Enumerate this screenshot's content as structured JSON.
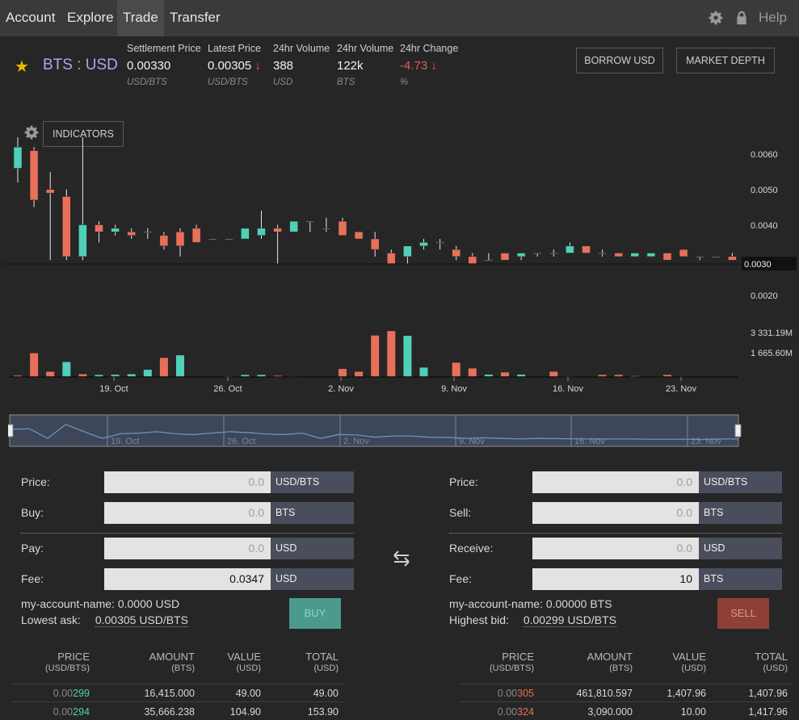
{
  "nav": {
    "items": [
      {
        "label": "Account",
        "active": false
      },
      {
        "label": "Explore",
        "active": false
      },
      {
        "label": "Trade",
        "active": true
      },
      {
        "label": "Transfer",
        "active": false
      }
    ],
    "help_label": "Help",
    "icons": [
      "gear-icon",
      "lock-icon"
    ]
  },
  "market": {
    "pair": "BTS : USD",
    "stats": [
      {
        "label": "Settlement Price",
        "value": "0.00330",
        "unit": "USD/BTS",
        "negative": false,
        "arrow": ""
      },
      {
        "label": "Latest Price",
        "value": "0.00305",
        "unit": "USD/BTS",
        "negative": false,
        "arrow": "↓"
      },
      {
        "label": "24hr Volume",
        "value": "388",
        "unit": "USD",
        "negative": false,
        "arrow": ""
      },
      {
        "label": "24hr Volume",
        "value": "122k",
        "unit": "BTS",
        "negative": false,
        "arrow": ""
      },
      {
        "label": "24hr Change",
        "value": "-4.73",
        "unit": "%",
        "negative": true,
        "arrow": "↓"
      }
    ],
    "borrow_label": "BORROW USD",
    "depth_label": "MARKET DEPTH"
  },
  "chart": {
    "indicators_label": "INDICATORS",
    "price_ticks": [
      "0.0060",
      "0.0050",
      "0.0040",
      "0.0030",
      "0.0020"
    ],
    "current_price_label": "0.0030",
    "volume_ticks": [
      "3 331.19M",
      "1 665.60M"
    ],
    "date_ticks": [
      "19. Oct",
      "26. Oct",
      "2. Nov",
      "9. Nov",
      "16. Nov",
      "23. Nov"
    ],
    "colors": {
      "up": "#4fd0b8",
      "down": "#e8705a"
    }
  },
  "chart_data": {
    "type": "candlestick",
    "ylim": [
      0.0015,
      0.0068
    ],
    "candles": [
      {
        "o": 0.0056,
        "h": 0.0066,
        "l": 0.0052,
        "c": 0.0062
      },
      {
        "o": 0.0061,
        "h": 0.0062,
        "l": 0.0045,
        "c": 0.0047
      },
      {
        "o": 0.005,
        "h": 0.0055,
        "l": 0.003,
        "c": 0.0049
      },
      {
        "o": 0.0048,
        "h": 0.005,
        "l": 0.003,
        "c": 0.0031
      },
      {
        "o": 0.0031,
        "h": 0.0066,
        "l": 0.003,
        "c": 0.004
      },
      {
        "o": 0.004,
        "h": 0.0041,
        "l": 0.0035,
        "c": 0.0038
      },
      {
        "o": 0.0038,
        "h": 0.004,
        "l": 0.0037,
        "c": 0.0039
      },
      {
        "o": 0.0038,
        "h": 0.0039,
        "l": 0.0036,
        "c": 0.0037
      },
      {
        "o": 0.0038,
        "h": 0.0039,
        "l": 0.0036,
        "c": 0.0038
      },
      {
        "o": 0.0037,
        "h": 0.0038,
        "l": 0.0033,
        "c": 0.0034
      },
      {
        "o": 0.0038,
        "h": 0.0039,
        "l": 0.0031,
        "c": 0.0034
      },
      {
        "o": 0.0039,
        "h": 0.004,
        "l": 0.0036,
        "c": 0.0035
      },
      {
        "o": 0.0036,
        "h": 0.0036,
        "l": 0.0036,
        "c": 0.0036
      },
      {
        "o": 0.0036,
        "h": 0.0036,
        "l": 0.0036,
        "c": 0.0036
      },
      {
        "o": 0.0036,
        "h": 0.0039,
        "l": 0.0036,
        "c": 0.0039
      },
      {
        "o": 0.0037,
        "h": 0.0044,
        "l": 0.0036,
        "c": 0.0039
      },
      {
        "o": 0.0039,
        "h": 0.004,
        "l": 0.0029,
        "c": 0.0038
      },
      {
        "o": 0.0038,
        "h": 0.0041,
        "l": 0.0038,
        "c": 0.0041
      },
      {
        "o": 0.0041,
        "h": 0.0041,
        "l": 0.0038,
        "c": 0.0041
      },
      {
        "o": 0.0039,
        "h": 0.0042,
        "l": 0.0038,
        "c": 0.0039
      },
      {
        "o": 0.0041,
        "h": 0.0042,
        "l": 0.0037,
        "c": 0.0037
      },
      {
        "o": 0.0038,
        "h": 0.0038,
        "l": 0.0036,
        "c": 0.0036
      },
      {
        "o": 0.0036,
        "h": 0.0038,
        "l": 0.0031,
        "c": 0.0033
      },
      {
        "o": 0.0032,
        "h": 0.0033,
        "l": 0.0029,
        "c": 0.0029
      },
      {
        "o": 0.0031,
        "h": 0.0034,
        "l": 0.0029,
        "c": 0.0034
      },
      {
        "o": 0.0034,
        "h": 0.0036,
        "l": 0.0033,
        "c": 0.0035
      },
      {
        "o": 0.0035,
        "h": 0.0036,
        "l": 0.0033,
        "c": 0.0035
      },
      {
        "o": 0.0033,
        "h": 0.0034,
        "l": 0.003,
        "c": 0.0031
      },
      {
        "o": 0.0031,
        "h": 0.0032,
        "l": 0.0029,
        "c": 0.0029
      },
      {
        "o": 0.003,
        "h": 0.0032,
        "l": 0.003,
        "c": 0.003
      },
      {
        "o": 0.0032,
        "h": 0.0032,
        "l": 0.003,
        "c": 0.003
      },
      {
        "o": 0.0031,
        "h": 0.0032,
        "l": 0.003,
        "c": 0.0032
      },
      {
        "o": 0.0032,
        "h": 0.0032,
        "l": 0.0031,
        "c": 0.0032
      },
      {
        "o": 0.0032,
        "h": 0.0033,
        "l": 0.0031,
        "c": 0.0032
      },
      {
        "o": 0.0032,
        "h": 0.0035,
        "l": 0.0032,
        "c": 0.0034
      },
      {
        "o": 0.0034,
        "h": 0.0034,
        "l": 0.0032,
        "c": 0.0032
      },
      {
        "o": 0.0032,
        "h": 0.0033,
        "l": 0.0031,
        "c": 0.0032
      },
      {
        "o": 0.0032,
        "h": 0.0032,
        "l": 0.0031,
        "c": 0.0031
      },
      {
        "o": 0.0031,
        "h": 0.0032,
        "l": 0.0031,
        "c": 0.0032
      },
      {
        "o": 0.0031,
        "h": 0.0032,
        "l": 0.0031,
        "c": 0.0032
      },
      {
        "o": 0.0032,
        "h": 0.0032,
        "l": 0.003,
        "c": 0.003
      },
      {
        "o": 0.0033,
        "h": 0.0033,
        "l": 0.0031,
        "c": 0.0031
      },
      {
        "o": 0.0031,
        "h": 0.0031,
        "l": 0.003,
        "c": 0.0031
      },
      {
        "o": 0.0031,
        "h": 0.0031,
        "l": 0.0031,
        "c": 0.0031
      },
      {
        "o": 0.0031,
        "h": 0.0032,
        "l": 0.003,
        "c": 0.003
      }
    ],
    "volume_ylim": [
      0,
      3700
    ],
    "volume": [
      {
        "v": 100,
        "up": false
      },
      {
        "v": 1720,
        "up": false
      },
      {
        "v": 380,
        "up": false
      },
      {
        "v": 1080,
        "up": true
      },
      {
        "v": 200,
        "up": false
      },
      {
        "v": 150,
        "up": true
      },
      {
        "v": 160,
        "up": true
      },
      {
        "v": 200,
        "up": true
      },
      {
        "v": 520,
        "up": true
      },
      {
        "v": 1380,
        "up": false
      },
      {
        "v": 1570,
        "up": true
      },
      {
        "v": 0,
        "up": true
      },
      {
        "v": 0,
        "up": true
      },
      {
        "v": 50,
        "up": true
      },
      {
        "v": 150,
        "up": true
      },
      {
        "v": 150,
        "up": true
      },
      {
        "v": 90,
        "up": false
      },
      {
        "v": 40,
        "up": true
      },
      {
        "v": 0,
        "up": true
      },
      {
        "v": 0,
        "up": true
      },
      {
        "v": 580,
        "up": false
      },
      {
        "v": 380,
        "up": false
      },
      {
        "v": 3000,
        "up": false
      },
      {
        "v": 3320,
        "up": false
      },
      {
        "v": 2980,
        "up": true
      },
      {
        "v": 680,
        "up": true
      },
      {
        "v": 0,
        "up": true
      },
      {
        "v": 1030,
        "up": false
      },
      {
        "v": 620,
        "up": false
      },
      {
        "v": 170,
        "up": true
      },
      {
        "v": 330,
        "up": false
      },
      {
        "v": 170,
        "up": true
      },
      {
        "v": 0,
        "up": true
      },
      {
        "v": 380,
        "up": false
      },
      {
        "v": 40,
        "up": true
      },
      {
        "v": 0,
        "up": true
      },
      {
        "v": 150,
        "up": false
      },
      {
        "v": 150,
        "up": false
      },
      {
        "v": 70,
        "up": true
      },
      {
        "v": 0,
        "up": true
      },
      {
        "v": 150,
        "up": false
      },
      {
        "v": 0,
        "up": true
      },
      {
        "v": 0,
        "up": true
      },
      {
        "v": 0,
        "up": true
      },
      {
        "v": 0,
        "up": true
      }
    ],
    "navigator": [
      0.47,
      0.45,
      0.78,
      0.3,
      0.55,
      0.78,
      0.62,
      0.6,
      0.55,
      0.62,
      0.65,
      0.6,
      0.55,
      0.58,
      0.63,
      0.65,
      0.6,
      0.78,
      0.65,
      0.66,
      0.74,
      0.7,
      0.7,
      0.74,
      0.75,
      0.78,
      0.76,
      0.78,
      0.8,
      0.78,
      0.79,
      0.8,
      0.8,
      0.8,
      0.8,
      0.81,
      0.81,
      0.81,
      0.82,
      0.8,
      0.8
    ]
  },
  "buy_form": {
    "price_label": "Price:",
    "price_value": "0.0",
    "price_unit": "USD/BTS",
    "amount_label": "Buy:",
    "amount_value": "0.0",
    "amount_unit": "BTS",
    "total_label": "Pay:",
    "total_value": "0.0",
    "total_unit": "USD",
    "fee_label": "Fee:",
    "fee_value": "0.0347",
    "fee_unit": "USD",
    "balance_label": "my-account-name:",
    "balance_value": "0.0000 USD",
    "best_label": "Lowest ask:",
    "best_value": "0.00305 USD/BTS",
    "button_label": "BUY"
  },
  "sell_form": {
    "price_label": "Price:",
    "price_value": "0.0",
    "price_unit": "USD/BTS",
    "amount_label": "Sell:",
    "amount_value": "0.0",
    "amount_unit": "BTS",
    "total_label": "Receive:",
    "total_value": "0.0",
    "total_unit": "USD",
    "fee_label": "Fee:",
    "fee_value": "10",
    "fee_unit": "BTS",
    "balance_label": "my-account-name:",
    "balance_value": "0.00000 BTS",
    "best_label": "Highest bid:",
    "best_value": "0.00299 USD/BTS",
    "button_label": "SELL"
  },
  "bids": {
    "headers": [
      {
        "label": "PRICE",
        "sub": "(USD/BTS)"
      },
      {
        "label": "AMOUNT",
        "sub": "(BTS)"
      },
      {
        "label": "VALUE",
        "sub": "(USD)"
      },
      {
        "label": "TOTAL",
        "sub": "(USD)"
      }
    ],
    "rows": [
      {
        "price_prefix": "0.00",
        "price_suffix": "299",
        "amount": "16,415.000",
        "value": "49.00",
        "total": "49.00"
      },
      {
        "price_prefix": "0.00",
        "price_suffix": "294",
        "amount": "35,666.238",
        "value": "104.90",
        "total": "153.90"
      }
    ]
  },
  "asks": {
    "headers": [
      {
        "label": "PRICE",
        "sub": "(USD/BTS)"
      },
      {
        "label": "AMOUNT",
        "sub": "(BTS)"
      },
      {
        "label": "VALUE",
        "sub": "(USD)"
      },
      {
        "label": "TOTAL",
        "sub": "(USD)"
      }
    ],
    "rows": [
      {
        "price_prefix": "0.00",
        "price_suffix": "305",
        "amount": "461,810.597",
        "value": "1,407.96",
        "total": "1,407.96"
      },
      {
        "price_prefix": "0.00",
        "price_suffix": "324",
        "amount": "3,090.000",
        "value": "10.00",
        "total": "1,417.96"
      }
    ]
  }
}
